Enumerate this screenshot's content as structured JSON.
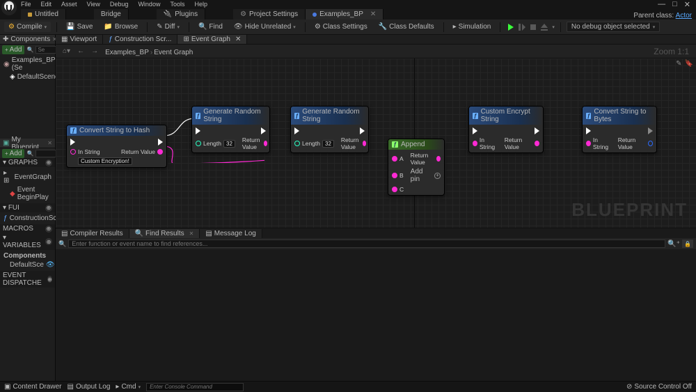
{
  "menubar": {
    "items": [
      "File",
      "Edit",
      "Asset",
      "View",
      "Debug",
      "Window",
      "Tools",
      "Help"
    ]
  },
  "window_controls": {
    "min": "—",
    "max": "□",
    "close": "✕"
  },
  "main_tabs": [
    {
      "label": "Untitled",
      "icon_color": "#c79a3a",
      "closeable": false
    },
    {
      "label": "Bridge",
      "icon_color": "#3a8ac7",
      "closeable": false
    },
    {
      "label": "Plugins",
      "icon_color": "#888",
      "closeable": false
    },
    {
      "label": "Project Settings",
      "icon_color": "#888",
      "closeable": false
    },
    {
      "label": "Examples_BP",
      "icon_color": "#4a7ae0",
      "closeable": true,
      "active": true
    }
  ],
  "parent_class": {
    "label": "Parent class:",
    "value": "Actor"
  },
  "toolbar": {
    "compile": "Compile",
    "save": "Save",
    "browse": "Browse",
    "diff": "Diff",
    "find": "Find",
    "hide": "Hide Unrelated",
    "class_settings": "Class Settings",
    "class_defaults": "Class Defaults",
    "simulation": "Simulation",
    "debug_select": "No debug object selected"
  },
  "components_panel": {
    "title": "Components",
    "add": "Add",
    "search_placeholder": "Se",
    "items": [
      {
        "label": "Examples_BP (Se",
        "indent": 0
      },
      {
        "label": "DefaultSceneR",
        "indent": 1
      }
    ]
  },
  "myblueprint_panel": {
    "title": "My Blueprint",
    "add": "Add",
    "search_placeholder": "",
    "sections": [
      {
        "name": "GRAPHS",
        "items": [
          {
            "label": "EventGraph",
            "children": [
              {
                "label": "Event BeginPlay"
              }
            ]
          }
        ]
      },
      {
        "name": "FUI",
        "items": [
          {
            "label": "ConstructionScrip"
          }
        ]
      },
      {
        "name": "MACROS",
        "items": []
      },
      {
        "name": "VARIABLES",
        "items": [
          {
            "sub": "Components",
            "children": [
              {
                "label": "DefaultSce"
              }
            ]
          }
        ]
      },
      {
        "name": "EVENT DISPATCHE",
        "items": []
      }
    ]
  },
  "graph_tabs": [
    {
      "label": "Viewport"
    },
    {
      "label": "Construction Scr..."
    },
    {
      "label": "Event Graph",
      "active": true,
      "closeable": true
    }
  ],
  "breadcrumb": {
    "root": "Examples_BP",
    "leaf": "Event Graph"
  },
  "zoom": "Zoom 1:1",
  "watermark": "BLUEPRINT",
  "nodes": {
    "hash": {
      "title": "Convert String to Hash",
      "in_str": "In String",
      "in_val": "Custom Encryption!",
      "ret": "Return Value"
    },
    "gen1": {
      "title": "Generate Random String",
      "len": "Length",
      "len_val": "32",
      "ret": "Return Value"
    },
    "gen2": {
      "title": "Generate Random String",
      "len": "Length",
      "len_val": "32",
      "ret": "Return Value"
    },
    "append": {
      "title": "Append",
      "a": "A",
      "b": "B",
      "c": "C",
      "ret": "Return Value",
      "addpin": "Add pin"
    },
    "encrypt": {
      "title": "Custom Encrypt String",
      "in_str": "In String",
      "ret": "Return Value"
    },
    "bytes": {
      "title": "Convert String to Bytes",
      "in_str": "In String",
      "ret": "Return Value"
    }
  },
  "result_tabs": [
    {
      "label": "Compiler Results"
    },
    {
      "label": "Find Results",
      "active": true,
      "closeable": true
    },
    {
      "label": "Message Log"
    }
  ],
  "find_placeholder": "Enter function or event name to find references...",
  "statusbar": {
    "content_drawer": "Content Drawer",
    "output_log": "Output Log",
    "cmd": "Cmd",
    "cmd_placeholder": "Enter Console Command",
    "source_control": "Source Control Off"
  }
}
